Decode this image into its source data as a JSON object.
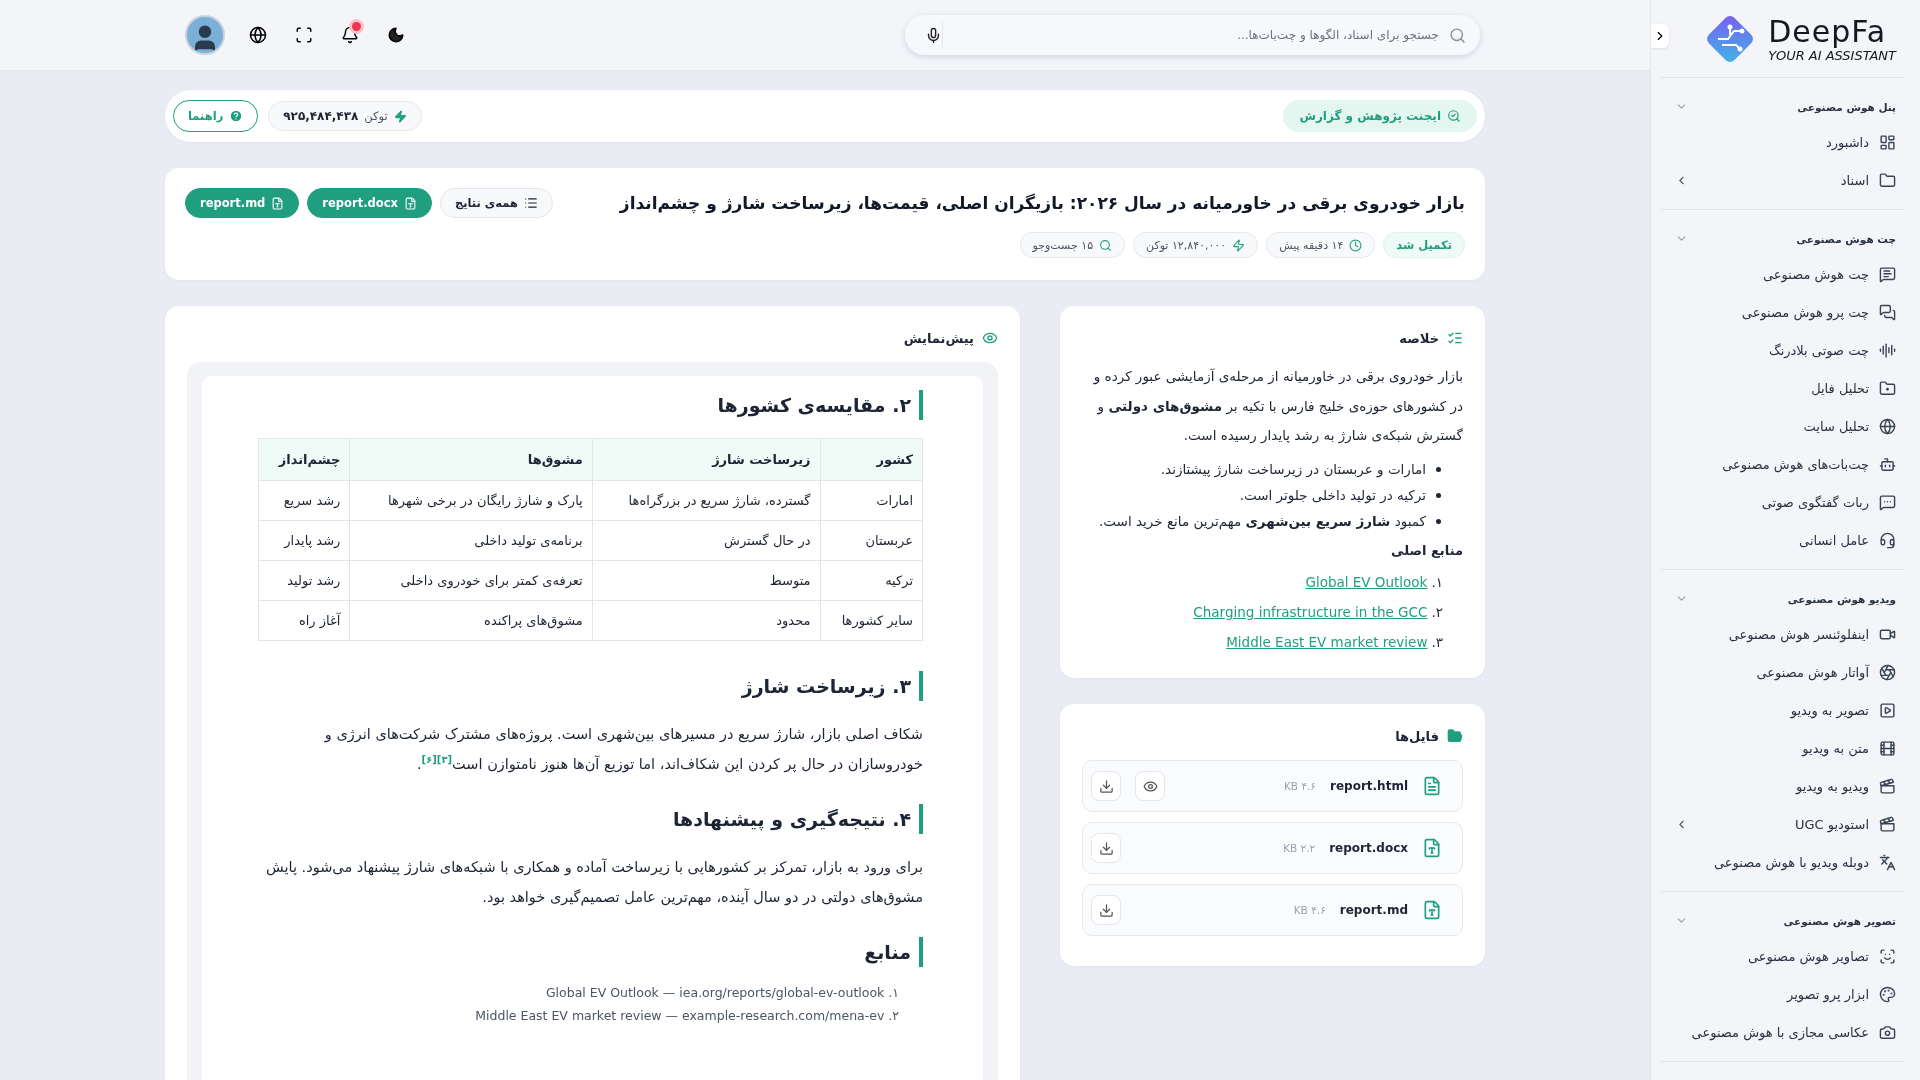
{
  "sidebar": {
    "logo": {
      "name": "DeepFa",
      "tagline": "YOUR AI ASSISTANT"
    },
    "groups": [
      {
        "title": "پنل هوش مصنوعی",
        "expanded": true,
        "items": [
          {
            "label": "داشبورد",
            "has_submenu": false
          },
          {
            "label": "اسناد",
            "has_submenu": true
          }
        ]
      },
      {
        "title": "چت هوش مصنوعی",
        "expanded": true,
        "items": [
          {
            "label": "چت هوش مصنوعی",
            "has_submenu": false
          },
          {
            "label": "چت پرو هوش مصنوعی",
            "has_submenu": false
          },
          {
            "label": "چت صوتی بلادرنگ",
            "has_submenu": false
          },
          {
            "label": "تحلیل فایل",
            "has_submenu": false
          },
          {
            "label": "تحلیل سایت",
            "has_submenu": false
          },
          {
            "label": "چت‌بات‌های هوش مصنوعی",
            "has_submenu": false
          },
          {
            "label": "ربات گفتگوی صوتی",
            "has_submenu": false
          },
          {
            "label": "عامل انسانی",
            "has_submenu": false
          }
        ]
      },
      {
        "title": "ویدیو هوش مصنوعی",
        "expanded": true,
        "items": [
          {
            "label": "اینفلوئنسر هوش مصنوعی",
            "has_submenu": false
          },
          {
            "label": "آواتار هوش مصنوعی",
            "has_submenu": false
          },
          {
            "label": "تصویر به ویدیو",
            "has_submenu": false
          },
          {
            "label": "متن به ویدیو",
            "has_submenu": false
          },
          {
            "label": "ویدیو به ویدیو",
            "has_submenu": false
          },
          {
            "label": "استودیو UGC",
            "has_submenu": true
          },
          {
            "label": "دوبله ویدیو با هوش مصنوعی",
            "has_submenu": false
          }
        ]
      },
      {
        "title": "تصویر هوش مصنوعی",
        "expanded": true,
        "items": [
          {
            "label": "تصاویر هوش مصنوعی",
            "has_submenu": false
          },
          {
            "label": "ابزار پرو تصویر",
            "has_submenu": false
          },
          {
            "label": "عکاسی مجازی با هوش مصنوعی",
            "has_submenu": false
          }
        ]
      }
    ]
  },
  "top_bar": {
    "search": {
      "placeholder": "جستجو برای اسناد، الگوها و چت‌بات‌ها..."
    },
    "has_notification": true
  },
  "agent_bar": {
    "agent": "ایجنت پژوهش و گزارش",
    "tokens": {
      "label": "توکن",
      "value": "۹۲۵,۴۸۴,۴۳۸"
    },
    "help": "راهنما"
  },
  "report": {
    "title": "بازار خودروی برقی در خاورمیانه در سال ۲۰۲۶: بازیگران اصلی، قیمت‌ها، زیرساخت شارژ و چشم‌انداز",
    "status": "تکمیل شد",
    "meta": [
      "۱۴ دقیقه پیش",
      "۱۲,۸۴۰,۰۰۰ توکن",
      "۱۵ جست‌وجو"
    ],
    "buttons": [
      {
        "label": "همه‌ی نتایج",
        "kind": "outline"
      },
      {
        "label": "report.docx",
        "kind": "file"
      },
      {
        "label": "report.md",
        "kind": "file"
      }
    ]
  },
  "preview": {
    "title": "پیش‌نمایش",
    "blocks": [
      {
        "kind": "heading",
        "text": "۲. مقایسه‌ی کشورها"
      },
      {
        "kind": "table",
        "columns": [
          "کشور",
          "زیرساخت شارژ",
          "مشوق‌ها",
          "چشم‌انداز"
        ],
        "rows": [
          [
            "امارات",
            "گسترده، شارژ سریع در بزرگراه‌ها",
            "پارک و شارژ رایگان در برخی شهرها",
            "رشد سریع"
          ],
          [
            "عربستان",
            "در حال گسترش",
            "برنامه‌ی تولید داخلی",
            "رشد پایدار"
          ],
          [
            "ترکیه",
            "متوسط",
            "تعرفه‌ی کمتر برای خودروی داخلی",
            "رشد تولید"
          ],
          [
            "سایر کشورها",
            "محدود",
            "مشوق‌های پراکنده",
            "آغاز راه"
          ]
        ]
      },
      {
        "kind": "heading",
        "text": "۳. زیرساخت شارژ"
      },
      {
        "kind": "paragraph",
        "text": "شکاف اصلی بازار، شارژ سریع در مسیرهای بین‌شهری است. پروژه‌های مشترک شرکت‌های انرژی و خودروسازان در حال پر کردن این شکاف‌اند، اما توزیع آن‌ها هنوز نامتوازن است$^{[۳][۶]}$."
      },
      {
        "kind": "heading",
        "text": "۴. نتیجه‌گیری و پیشنهادها"
      },
      {
        "kind": "paragraph",
        "text": "برای ورود به بازار، تمرکز بر کشورهایی با زیرساخت آماده و همکاری با شبکه‌های شارژ پیشنهاد می‌شود. پایش مشوق‌های دولتی در دو سال آینده، مهم‌ترین عامل تصمیم‌گیری خواهد بود."
      },
      {
        "kind": "heading",
        "text": "منابع"
      },
      {
        "kind": "references",
        "items": [
          "۱. Global EV Outlook — iea.org/reports/global-ev-outlook",
          "۲. Middle East EV market review — example-research.com/mena-ev"
        ]
      }
    ]
  },
  "summary": {
    "title": "خلاصه",
    "text": "بازار خودروی برقی در خاورمیانه از مرحله‌ی آزمایشی عبور کرده و در کشورهای حوزه‌ی خلیج فارس با تکیه بر **مشوق‌های دولتی** و گسترش شبکه‌ی شارژ به رشد پایدار رسیده است.",
    "bullets": [
      "امارات و عربستان در زیرساخت شارژ پیشتازند.",
      "ترکیه در تولید داخلی جلوتر است.",
      "کمبود **شارژ سریع بین‌شهری** مهم‌ترین مانع خرید است."
    ],
    "sources_title": "منابع اصلی",
    "sources": [
      {
        "number": "۱.",
        "title": "Global EV Outlook"
      },
      {
        "number": "۲.",
        "title": "Charging infrastructure in the GCC"
      },
      {
        "number": "۳.",
        "title": "Middle East EV market review"
      }
    ]
  },
  "files": {
    "title": "فایل‌ها",
    "items": [
      {
        "name": "report.html",
        "size": "۴.۶ KB",
        "kind": "html",
        "previewable": true
      },
      {
        "name": "report.docx",
        "size": "۲.۲ KB",
        "kind": "word",
        "previewable": false
      },
      {
        "name": "report.md",
        "size": "۴.۶ KB",
        "kind": "word",
        "previewable": false
      }
    ]
  }
}
